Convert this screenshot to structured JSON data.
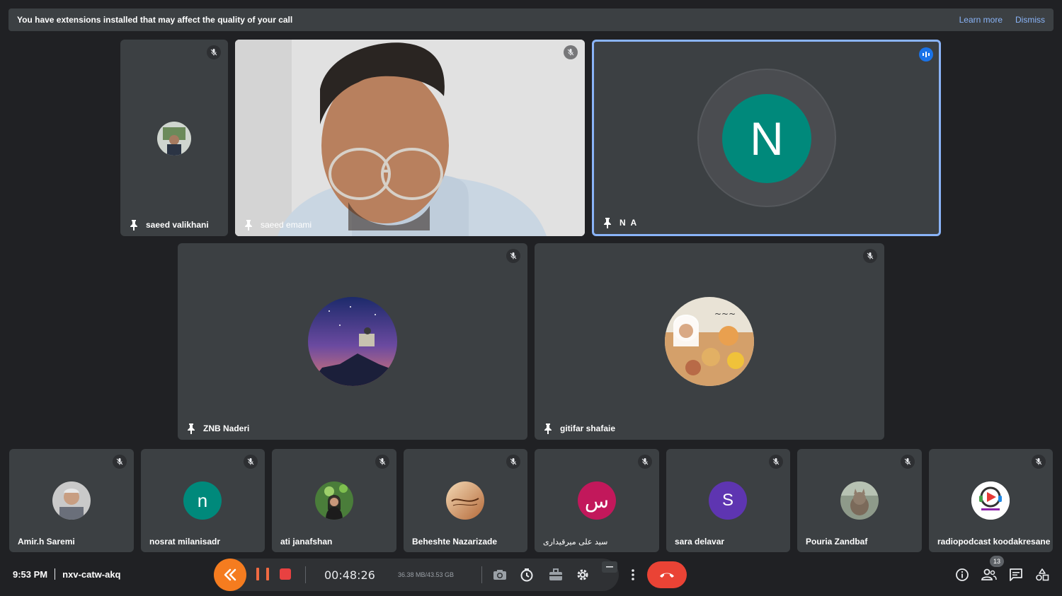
{
  "banner": {
    "message": "You have extensions installed that may affect the quality of your call",
    "learn_more": "Learn more",
    "dismiss": "Dismiss"
  },
  "participants": {
    "p1": {
      "name": "saeed valikhani"
    },
    "p2": {
      "name": "saeed emami"
    },
    "p3": {
      "name": "N A",
      "initial": "N",
      "avatar_color": "#00897b"
    },
    "p4": {
      "name": "ZNB Naderi"
    },
    "p5": {
      "name": "gitifar shafaie"
    },
    "p6": {
      "name": "Amir.h Saremi"
    },
    "p7": {
      "name": "nosrat milanisadr",
      "initial": "n",
      "avatar_color": "#00897b"
    },
    "p8": {
      "name": "ati janafshan"
    },
    "p9": {
      "name": "Beheshte Nazarizade"
    },
    "p10": {
      "name": "سید علی میرقیداری",
      "initial": "س",
      "avatar_color": "#c2185b"
    },
    "p11": {
      "name": "sara delavar",
      "initial": "S",
      "avatar_color": "#5e35b1"
    },
    "p12": {
      "name": "Pouria Zandbaf"
    },
    "p13": {
      "name": "radiopodcast koodakresane"
    }
  },
  "bottom": {
    "time": "9:53 PM",
    "meeting_code": "nxv-catw-akq",
    "participant_count": "13"
  },
  "recorder": {
    "elapsed": "00:48:26",
    "size": "36.38 MB/43.53 GB",
    "accent": "#f57c1f"
  },
  "icons": {
    "mic_off": "mic-off-icon",
    "pin": "pin-icon",
    "speaking": "audio-level-icon",
    "end_call": "phone-hangup-icon",
    "info": "info-icon",
    "people": "people-icon",
    "chat": "chat-icon",
    "activities": "activities-icon"
  }
}
